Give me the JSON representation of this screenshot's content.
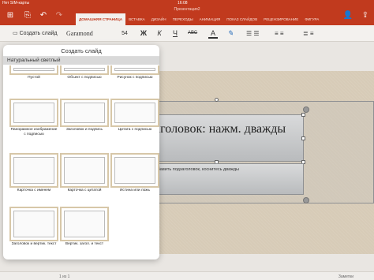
{
  "status": {
    "carrier": "Нет SIM-карты",
    "time": "16:08",
    "battery": ""
  },
  "app": {
    "title": "Презентация2"
  },
  "toolbar_icons": [
    "grid-icon",
    "save-icon",
    "undo-icon",
    "redo-icon",
    "add-person-icon",
    "share-icon"
  ],
  "tabs": [
    {
      "label": "ДОМАШНЯЯ СТРАНИЦА",
      "active": true
    },
    {
      "label": "ВСТАВКА"
    },
    {
      "label": "ДИЗАЙН"
    },
    {
      "label": "ПЕРЕХОДЫ"
    },
    {
      "label": "АНИМАЦИЯ"
    },
    {
      "label": "ПОКАЗ СЛАЙДОВ"
    },
    {
      "label": "РЕЦЕНЗИРОВАНИЕ"
    },
    {
      "label": "ФИГУРА"
    }
  ],
  "ribbon": {
    "new_slide": "Создать слайд",
    "font_name": "Garamond",
    "font_size": "54",
    "bold": "Ж",
    "italic": "К",
    "underline": "Ч",
    "strike": "АВС",
    "font_color": "А"
  },
  "panel": {
    "title": "Создать слайд",
    "theme": "Натуральный светлый",
    "layouts": [
      {
        "label": "Пустой"
      },
      {
        "label": "Объект с подписью"
      },
      {
        "label": "Рисунок с подписью"
      },
      {
        "label": "Панорамное изображение с подписью"
      },
      {
        "label": "Заголовок и подпись"
      },
      {
        "label": "Цитата с подписью"
      },
      {
        "label": "Карточка с именем"
      },
      {
        "label": "Карточка с цитатой"
      },
      {
        "label": "Истина или ложь"
      },
      {
        "label": "Заголовок и вертик. текст"
      },
      {
        "label": "Вертик. загол. и текст"
      }
    ]
  },
  "slide": {
    "title": "Заголовок: нажм. дважды",
    "subtitle": "ы добавить подзаголовок, коснитесь дважды"
  },
  "bottom": {
    "count": "1 из 1",
    "notes": "Заметки"
  },
  "colors": {
    "accent": "#c13a1e",
    "ribbon": "#f3f1ee"
  }
}
